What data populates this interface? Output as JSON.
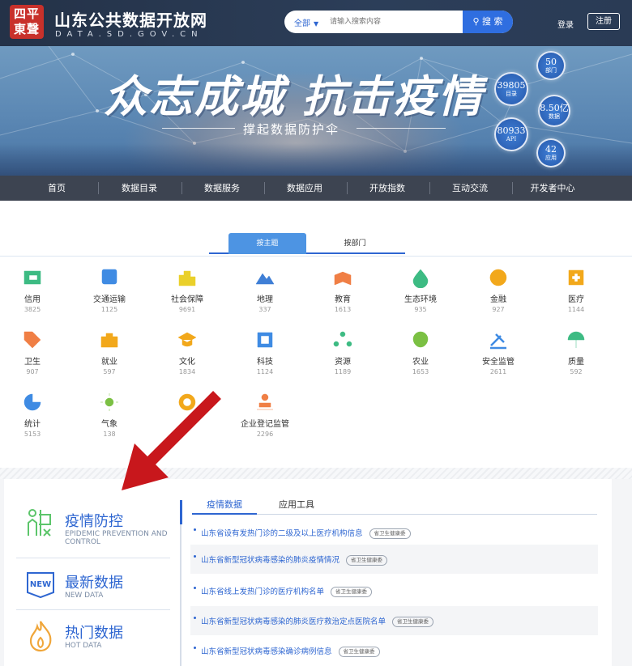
{
  "header": {
    "seal_text": "四平東聲",
    "site_title": "山东公共数据开放网",
    "site_subtitle": "DATA.SD.GOV.CN",
    "search_scope": "全部",
    "search_placeholder": "请输入搜索内容",
    "search_button": "搜 索",
    "login": "登录",
    "register": "注册"
  },
  "banner": {
    "headline": "众志成城 抗击疫情",
    "tagline": "撑起数据防护伞",
    "stats": [
      {
        "value": "50",
        "label": "部门"
      },
      {
        "value": "39805",
        "label": "目录"
      },
      {
        "value": "8.50亿",
        "label": "数据"
      },
      {
        "value": "80933",
        "label": "API"
      },
      {
        "value": "42",
        "label": "应用"
      }
    ]
  },
  "nav": [
    "首页",
    "数据目录",
    "数据服务",
    "数据应用",
    "开放指数",
    "互动交流",
    "开发者中心"
  ],
  "theme_tabs": {
    "active": "按主题",
    "other": "按部门"
  },
  "categories": [
    {
      "name": "信用",
      "count": "3825",
      "color": "#3dbb83"
    },
    {
      "name": "交通运输",
      "count": "1125",
      "color": "#3f8be3"
    },
    {
      "name": "社会保障",
      "count": "9691",
      "color": "#ead02a"
    },
    {
      "name": "地理",
      "count": "337",
      "color": "#3f7fd6"
    },
    {
      "name": "教育",
      "count": "1613",
      "color": "#f07f45"
    },
    {
      "name": "生态环境",
      "count": "935",
      "color": "#3dbb83"
    },
    {
      "name": "金融",
      "count": "927",
      "color": "#f2a81b"
    },
    {
      "name": "医疗",
      "count": "1144",
      "color": "#f2a81b"
    },
    {
      "name": "卫生",
      "count": "907",
      "color": "#f07f45"
    },
    {
      "name": "就业",
      "count": "597",
      "color": "#f2a81b"
    },
    {
      "name": "文化",
      "count": "1834",
      "color": "#f2a81b"
    },
    {
      "name": "科技",
      "count": "1124",
      "color": "#3f8be3"
    },
    {
      "name": "资源",
      "count": "1189",
      "color": "#3dbb83"
    },
    {
      "name": "农业",
      "count": "1653",
      "color": "#7bc043"
    },
    {
      "name": "安全监管",
      "count": "2611",
      "color": "#3f8be3"
    },
    {
      "name": "质量",
      "count": "592",
      "color": "#3dbb83"
    },
    {
      "name": "统计",
      "count": "5153",
      "color": "#3f8be3"
    },
    {
      "name": "气象",
      "count": "138",
      "color": "#7bc043"
    },
    {
      "name": "",
      "count": "",
      "color": "#f2a81b"
    },
    {
      "name": "企业登记监管",
      "count": "2296",
      "color": "#f07f45"
    }
  ],
  "side_menu": [
    {
      "title": "疫情防控",
      "sub": "EPIDEMIC PREVENTION AND CONTROL",
      "icon": "epidemic-icon"
    },
    {
      "title": "最新数据",
      "sub": "NEW DATA",
      "icon": "new-icon"
    },
    {
      "title": "热门数据",
      "sub": "HOT DATA",
      "icon": "fire-icon"
    }
  ],
  "sub_tabs": [
    "疫情数据",
    "应用工具"
  ],
  "rows": [
    {
      "text": "山东省设有发热门诊的二级及以上医疗机构信息",
      "tag": "省卫生健康委"
    },
    {
      "text": "山东省新型冠状病毒感染的肺炎疫情情况",
      "tag": "省卫生健康委"
    },
    {
      "text": "山东省线上发热门诊的医疗机构名单",
      "tag": "省卫生健康委"
    },
    {
      "text": "山东省新型冠状病毒感染的肺炎医疗救治定点医院名单",
      "tag": "省卫生健康委"
    },
    {
      "text": "山东省新型冠状病毒感染确诊病例信息",
      "tag": "省卫生健康委"
    }
  ],
  "colors": {
    "brand": "#2e66d1",
    "header": "#263550",
    "annotation_arrow": "#c8171c"
  }
}
